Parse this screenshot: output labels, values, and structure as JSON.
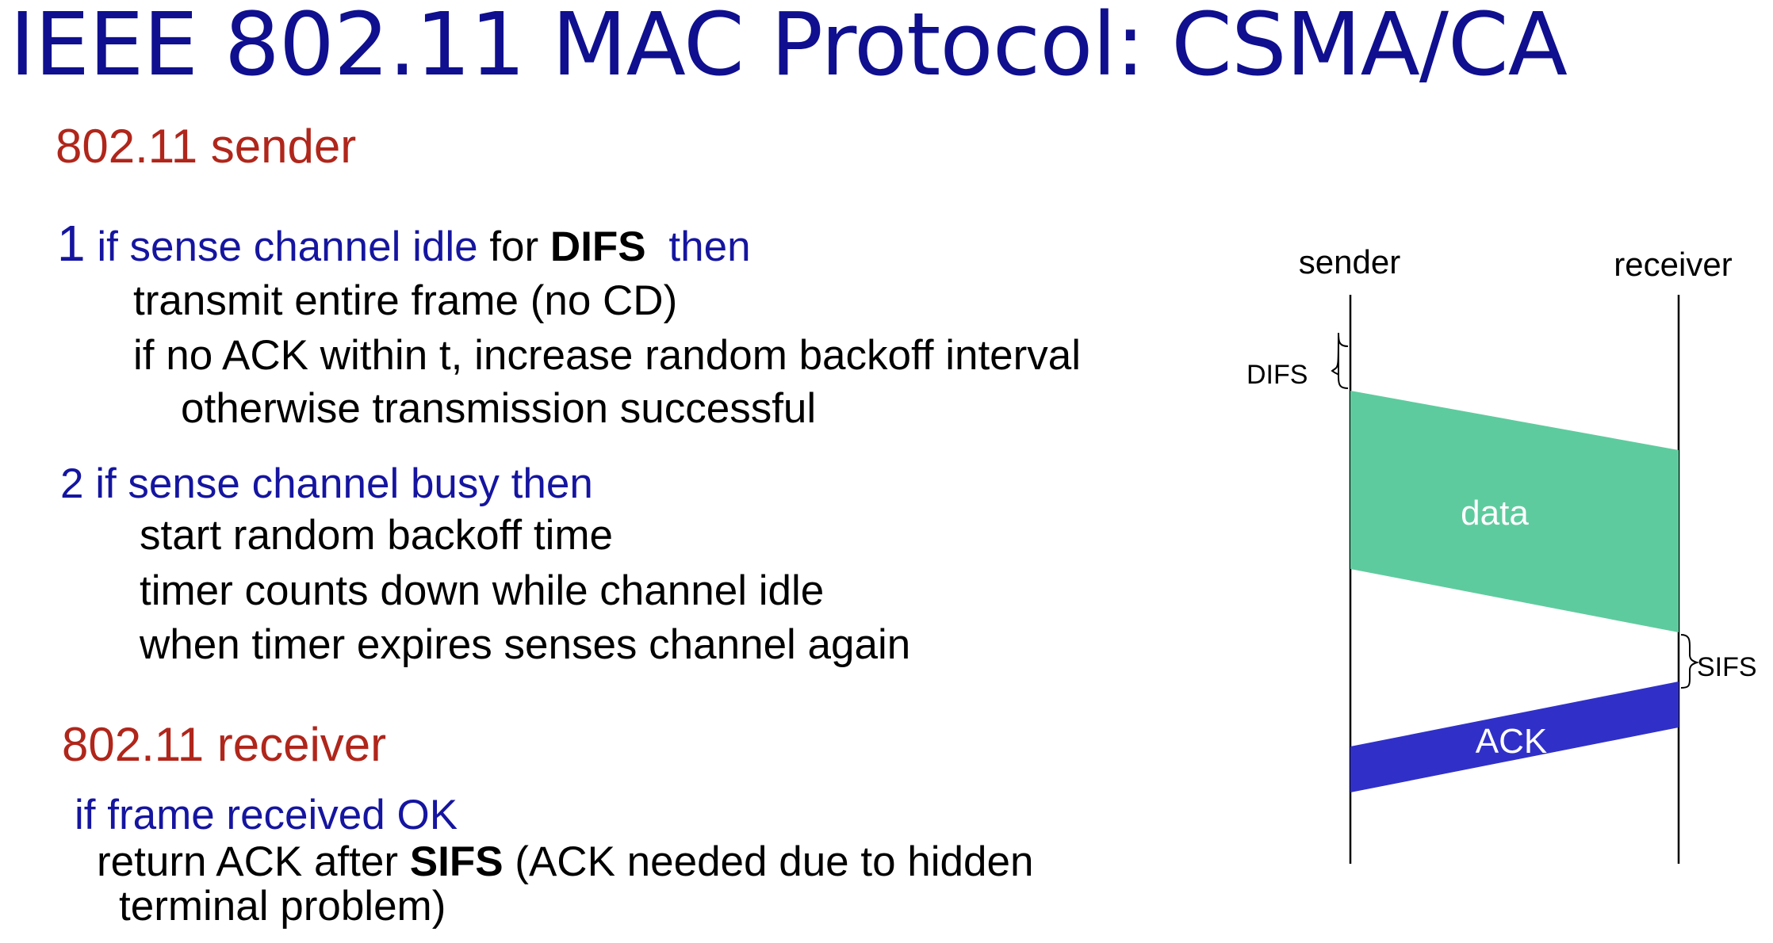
{
  "slide": {
    "title": "IEEE 802.11 MAC Protocol: CSMA/CA"
  },
  "sender_section": {
    "heading": "802.11 sender",
    "step1": {
      "number": "1",
      "condition_a": "if sense channel idle",
      "condition_b": "for",
      "keyword": "DIFS",
      "then": "then",
      "lines": [
        "transmit entire frame (no CD)",
        "if no ACK within t, increase random backoff interval",
        "otherwise transmission successful"
      ]
    },
    "step2": {
      "condition": "2 if sense channel busy then",
      "lines": [
        "start random backoff time",
        "timer counts down while channel idle",
        "when timer expires senses channel again"
      ]
    }
  },
  "receiver_section": {
    "heading": "802.11 receiver",
    "condition": "if frame received OK",
    "action_a": "return ACK after",
    "keyword": "SIFS",
    "action_b": "(ACK needed due to hidden",
    "action_c": "terminal problem)"
  },
  "diagram": {
    "sender_label": "sender",
    "receiver_label": "receiver",
    "difs_label": "DIFS",
    "sifs_label": "SIFS",
    "data_label": "data",
    "ack_label": "ACK",
    "colors": {
      "data_fill": "#5ecb9e",
      "ack_fill": "#3030c8",
      "timeline": "#000000"
    }
  }
}
